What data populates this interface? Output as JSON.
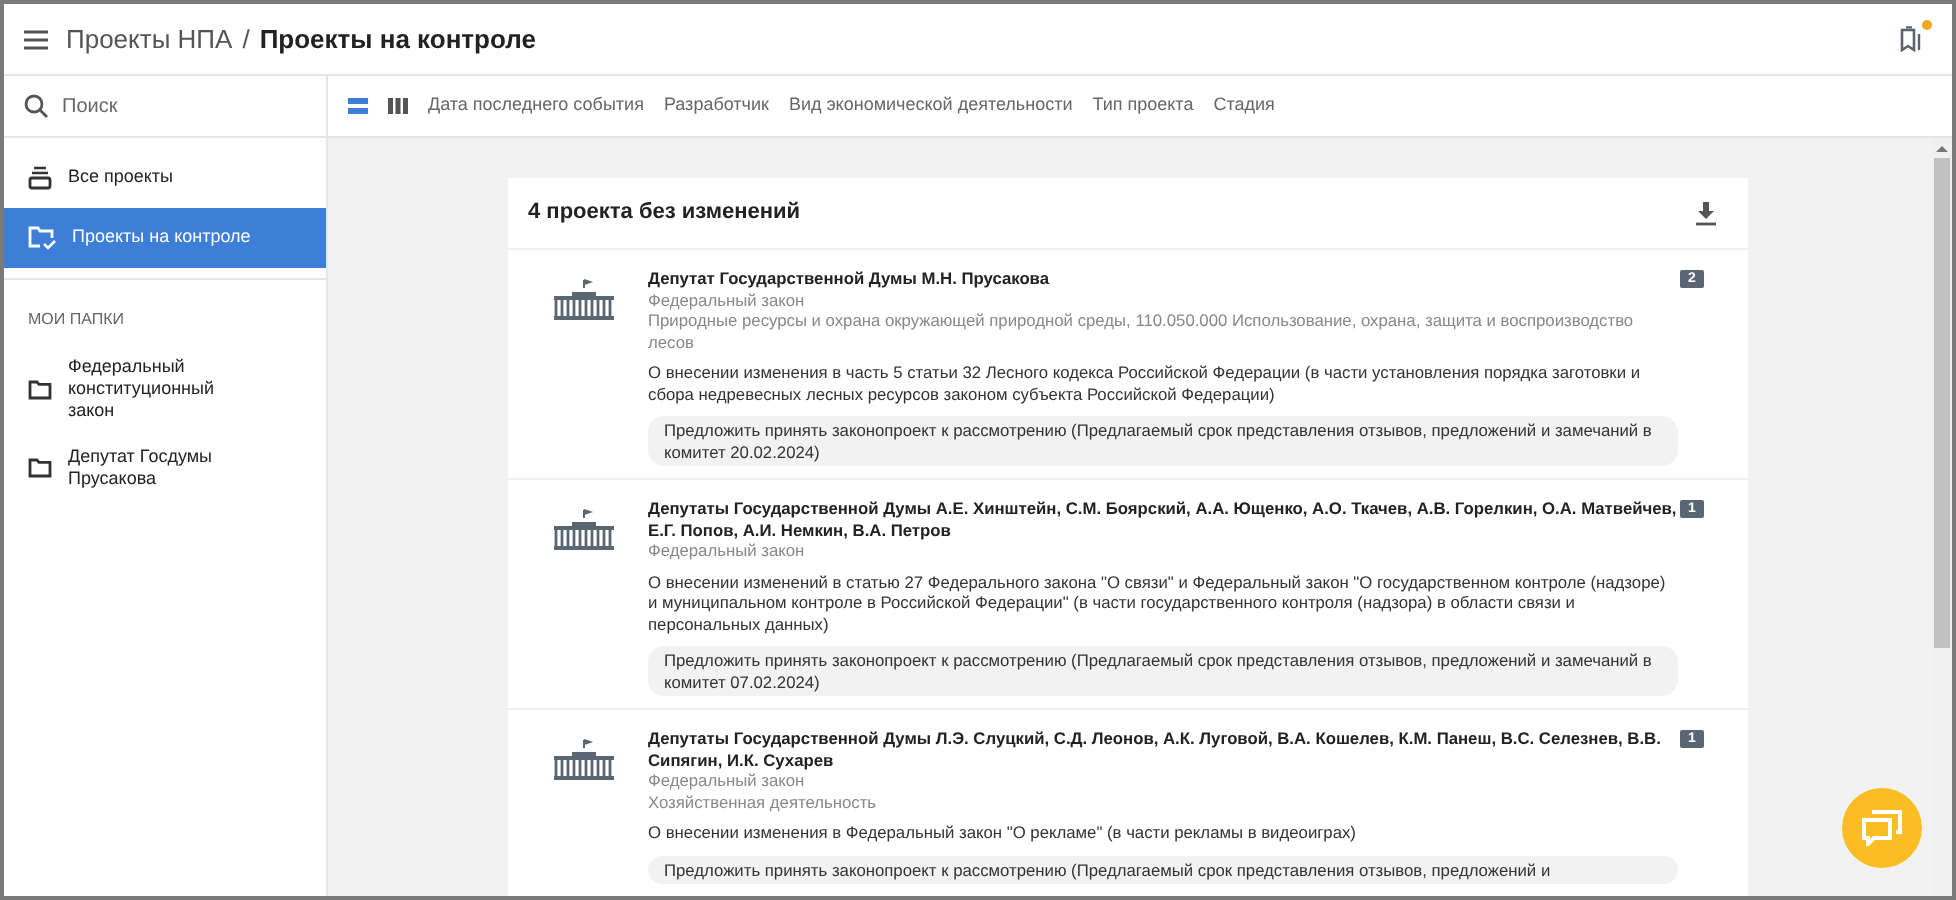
{
  "header": {
    "breadcrumb": "Проекты НПА",
    "separator": "/",
    "title": "Проекты на контроле",
    "has_notification": true
  },
  "search": {
    "placeholder": "Поиск"
  },
  "sidebar": {
    "items": [
      {
        "label": "Все проекты",
        "kind": "all",
        "selected": false
      },
      {
        "label": "Проекты на контроле",
        "kind": "watch",
        "selected": true
      }
    ],
    "folders_heading": "МОИ ПАПКИ",
    "folders": [
      {
        "label": "Федеральный конституционный закон"
      },
      {
        "label": "Депутат Госдумы Прусакова"
      }
    ]
  },
  "view_modes": [
    {
      "kind": "list",
      "selected": true
    },
    {
      "kind": "columns",
      "selected": false
    }
  ],
  "filters": [
    "Дата последнего события",
    "Разработчик",
    "Вид экономической деятельности",
    "Тип проекта",
    "Стадия"
  ],
  "list": {
    "title": "4 проекта без изменений",
    "projects": [
      {
        "author": "Депутат Государственной Думы М.Н. Прусакова",
        "type": "Федеральный закон",
        "area": "Природные ресурсы и охрана окружающей природной среды, 110.050.000 Использование, охрана, защита и воспроизводство лесов",
        "name": "О внесении изменения в часть 5 статьи 32 Лесного кодекса Российской Федерации (в части установления порядка заготовки и сбора недревесных лесных ресурсов законом субъекта Российской Федерации)",
        "stage": "Предложить принять законопроект к рассмотрению (Предлагаемый срок представления отзывов, предложений и замечаний в комитет 20.02.2024)",
        "folders_count": "2"
      },
      {
        "author": "Депутаты Государственной Думы А.Е. Хинштейн, С.М. Боярский, А.А. Ющенко, А.О. Ткачев, А.В. Горелкин, О.А. Матвейчев, Е.Г. Попов, А.И. Немкин, В.А. Петров",
        "type": "Федеральный закон",
        "name": "О внесении изменений в статью 27 Федерального закона \"О связи\" и Федеральный закон \"О государственном контроле (надзоре) и муниципальном контроле в Российской Федерации\" (в части государственного контроля (надзора) в области связи и персональных данных)",
        "stage": "Предложить принять законопроект к рассмотрению (Предлагаемый срок представления отзывов, предложений и замечаний в комитет 07.02.2024)",
        "folders_count": "1"
      },
      {
        "author": "Депутаты Государственной Думы Л.Э. Слуцкий, С.Д. Леонов, А.К. Луговой, В.А. Кошелев, К.М. Панеш, В.С. Селезнев, В.В. Сипягин, И.К. Сухарев",
        "type": "Федеральный закон",
        "area": "Хозяйственная деятельность",
        "name": "О внесении изменения в Федеральный закон \"О рекламе\" (в части рекламы в видеоиграх)",
        "stage": "Предложить принять законопроект к рассмотрению (Предлагаемый срок представления отзывов, предложений и",
        "folders_count": "1"
      }
    ]
  }
}
